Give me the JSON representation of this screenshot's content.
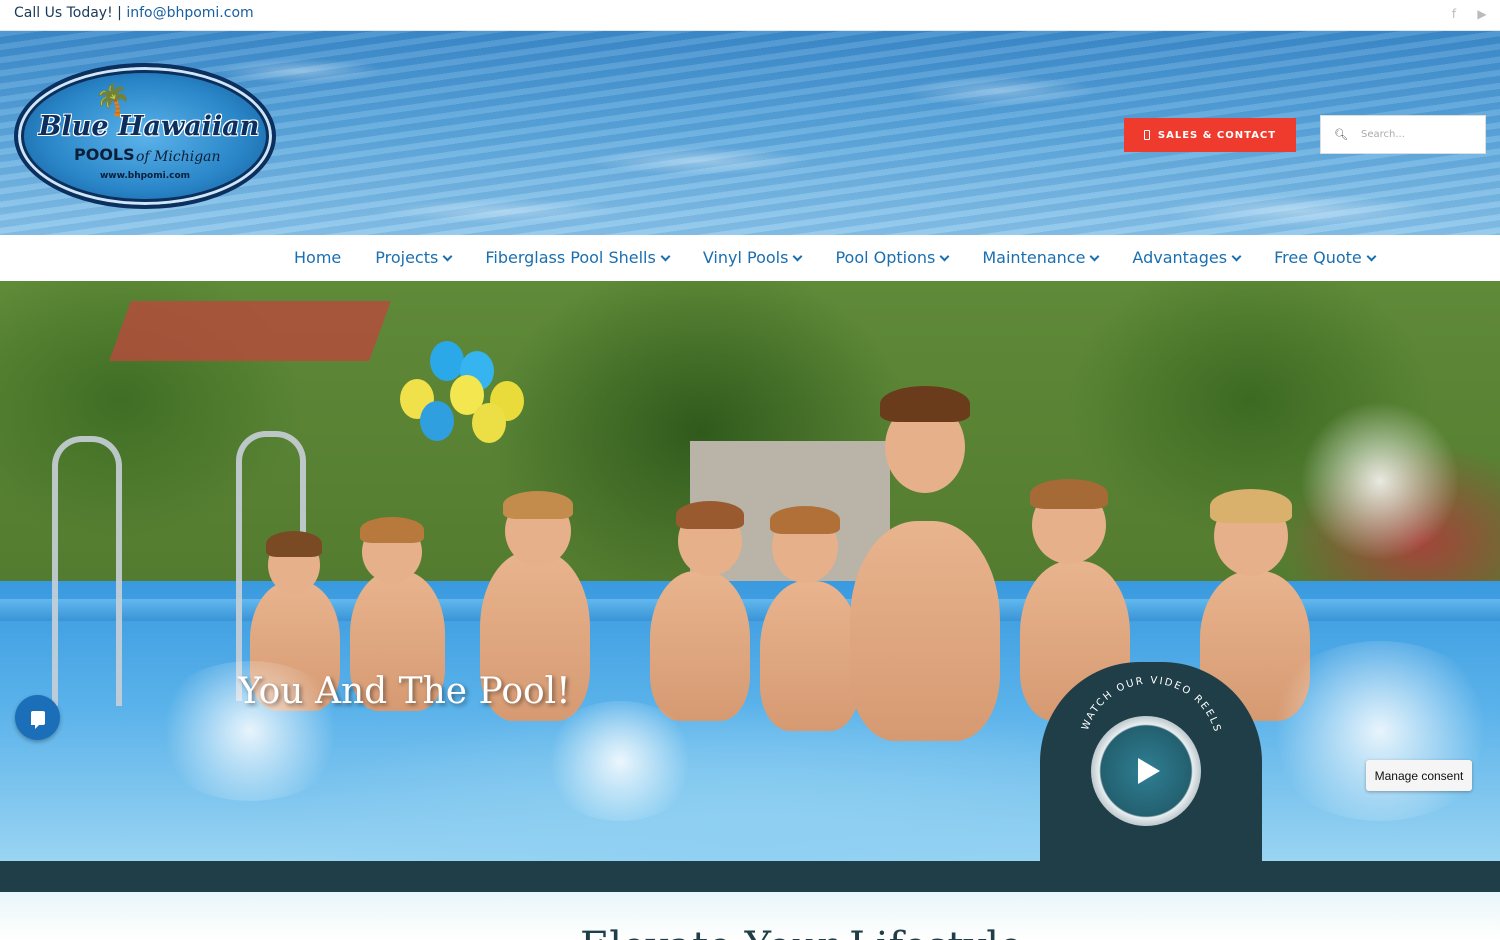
{
  "topbar": {
    "phone_label": "Call Us Today!",
    "separator": "|",
    "email": "info@bhpomi.com",
    "social": [
      "facebook-icon",
      "youtube-icon"
    ]
  },
  "logo": {
    "brand": "Blue Hawaiian",
    "pools": "POOLS",
    "state": "of Michigan",
    "url": "www.bhpomi.com"
  },
  "header": {
    "sales_button": "SALES & CONTACT",
    "search_placeholder": "Search..."
  },
  "nav": {
    "items": [
      {
        "label": "Home",
        "dropdown": false
      },
      {
        "label": "Projects",
        "dropdown": true
      },
      {
        "label": "Fiberglass Pool Shells",
        "dropdown": true
      },
      {
        "label": "Vinyl Pools",
        "dropdown": true
      },
      {
        "label": "Pool Options",
        "dropdown": true
      },
      {
        "label": "Maintenance",
        "dropdown": true
      },
      {
        "label": "Advantages",
        "dropdown": true
      },
      {
        "label": "Free Quote",
        "dropdown": true
      }
    ]
  },
  "hero": {
    "title": "You And The Pool!",
    "video_ring_text": "WATCH OUR VIDEO REELS"
  },
  "consent": {
    "label": "Manage consent"
  },
  "section": {
    "heading": "Elevate Your Lifestyle"
  },
  "colors": {
    "accent_red": "#ee3b2e",
    "nav_blue": "#1a6fb0",
    "dark_teal": "#1f3e47"
  }
}
